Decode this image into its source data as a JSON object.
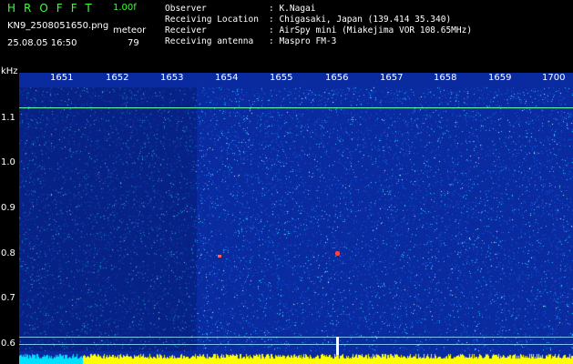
{
  "header": {
    "brand": "HROFFT",
    "version": "1.00f",
    "filename": "KN9_2508051650.png",
    "meteor_label": "meteor",
    "datetime": "25.08.05 16:50",
    "meteor_count": "79",
    "info": [
      {
        "key": "Observer",
        "value": ": K.Nagai"
      },
      {
        "key": "Receiving Location",
        "value": ": Chigasaki, Japan (139.414 35.340)"
      },
      {
        "key": "Receiver",
        "value": ": AirSpy mini (Miakejima VOR 108.65MHz)"
      },
      {
        "key": "Receiving antenna",
        "value": ": Maspro FM-3"
      }
    ]
  },
  "spectrogram": {
    "y_unit": "kHz",
    "time_ticks": [
      "1651",
      "1652",
      "1653",
      "1654",
      "1655",
      "1656",
      "1657",
      "1658",
      "1659",
      "1700"
    ],
    "freq_ticks": [
      "1.1",
      "1.0",
      "0.9",
      "0.8",
      "0.7",
      "0.6"
    ],
    "colors": {
      "background": "#0a2aa0",
      "noise_high": "#2ad0ff",
      "noise_mid": "#1460e0",
      "carrier": "#7cffa0",
      "meteor": "#ff4040",
      "baseline": "#ffff00",
      "baseline_cyan": "#00e0ff"
    }
  }
}
